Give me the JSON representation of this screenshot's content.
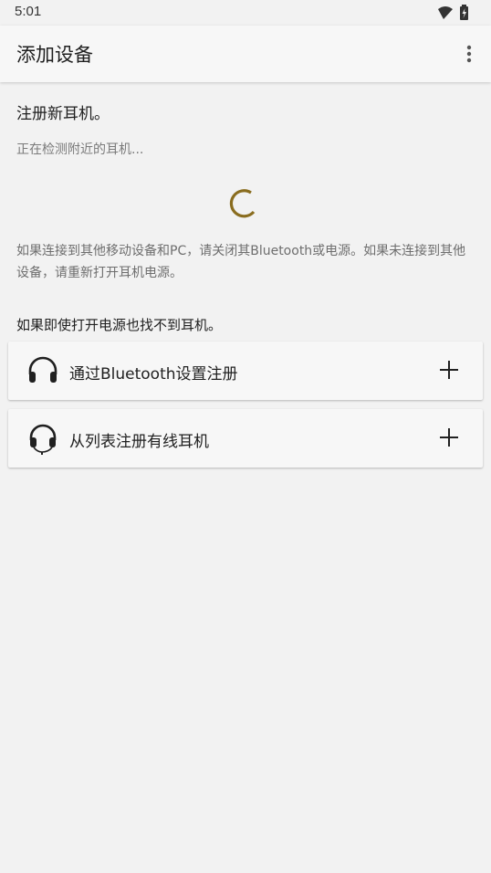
{
  "status_bar": {
    "time": "5:01",
    "icons": [
      "wifi-icon",
      "battery-charging-icon"
    ]
  },
  "app_bar": {
    "title": "添加设备",
    "menu_icon": "more-vert-icon"
  },
  "content": {
    "heading": "注册新耳机。",
    "detecting_text": "正在检测附近的耳机...",
    "spinner_color": "#8a6d1f",
    "info_text": "如果连接到其他移动设备和PC，请关闭其Bluetooth或电源。如果未连接到其他设备，请重新打开耳机电源。",
    "help_label": "如果即使打开电源也找不到耳机。"
  },
  "options": [
    {
      "label": "通过Bluetooth设置注册",
      "icon": "headphones-icon",
      "action_icon": "plus-icon"
    },
    {
      "label": "从列表注册有线耳机",
      "icon": "wired-headphones-icon",
      "action_icon": "plus-icon"
    }
  ]
}
